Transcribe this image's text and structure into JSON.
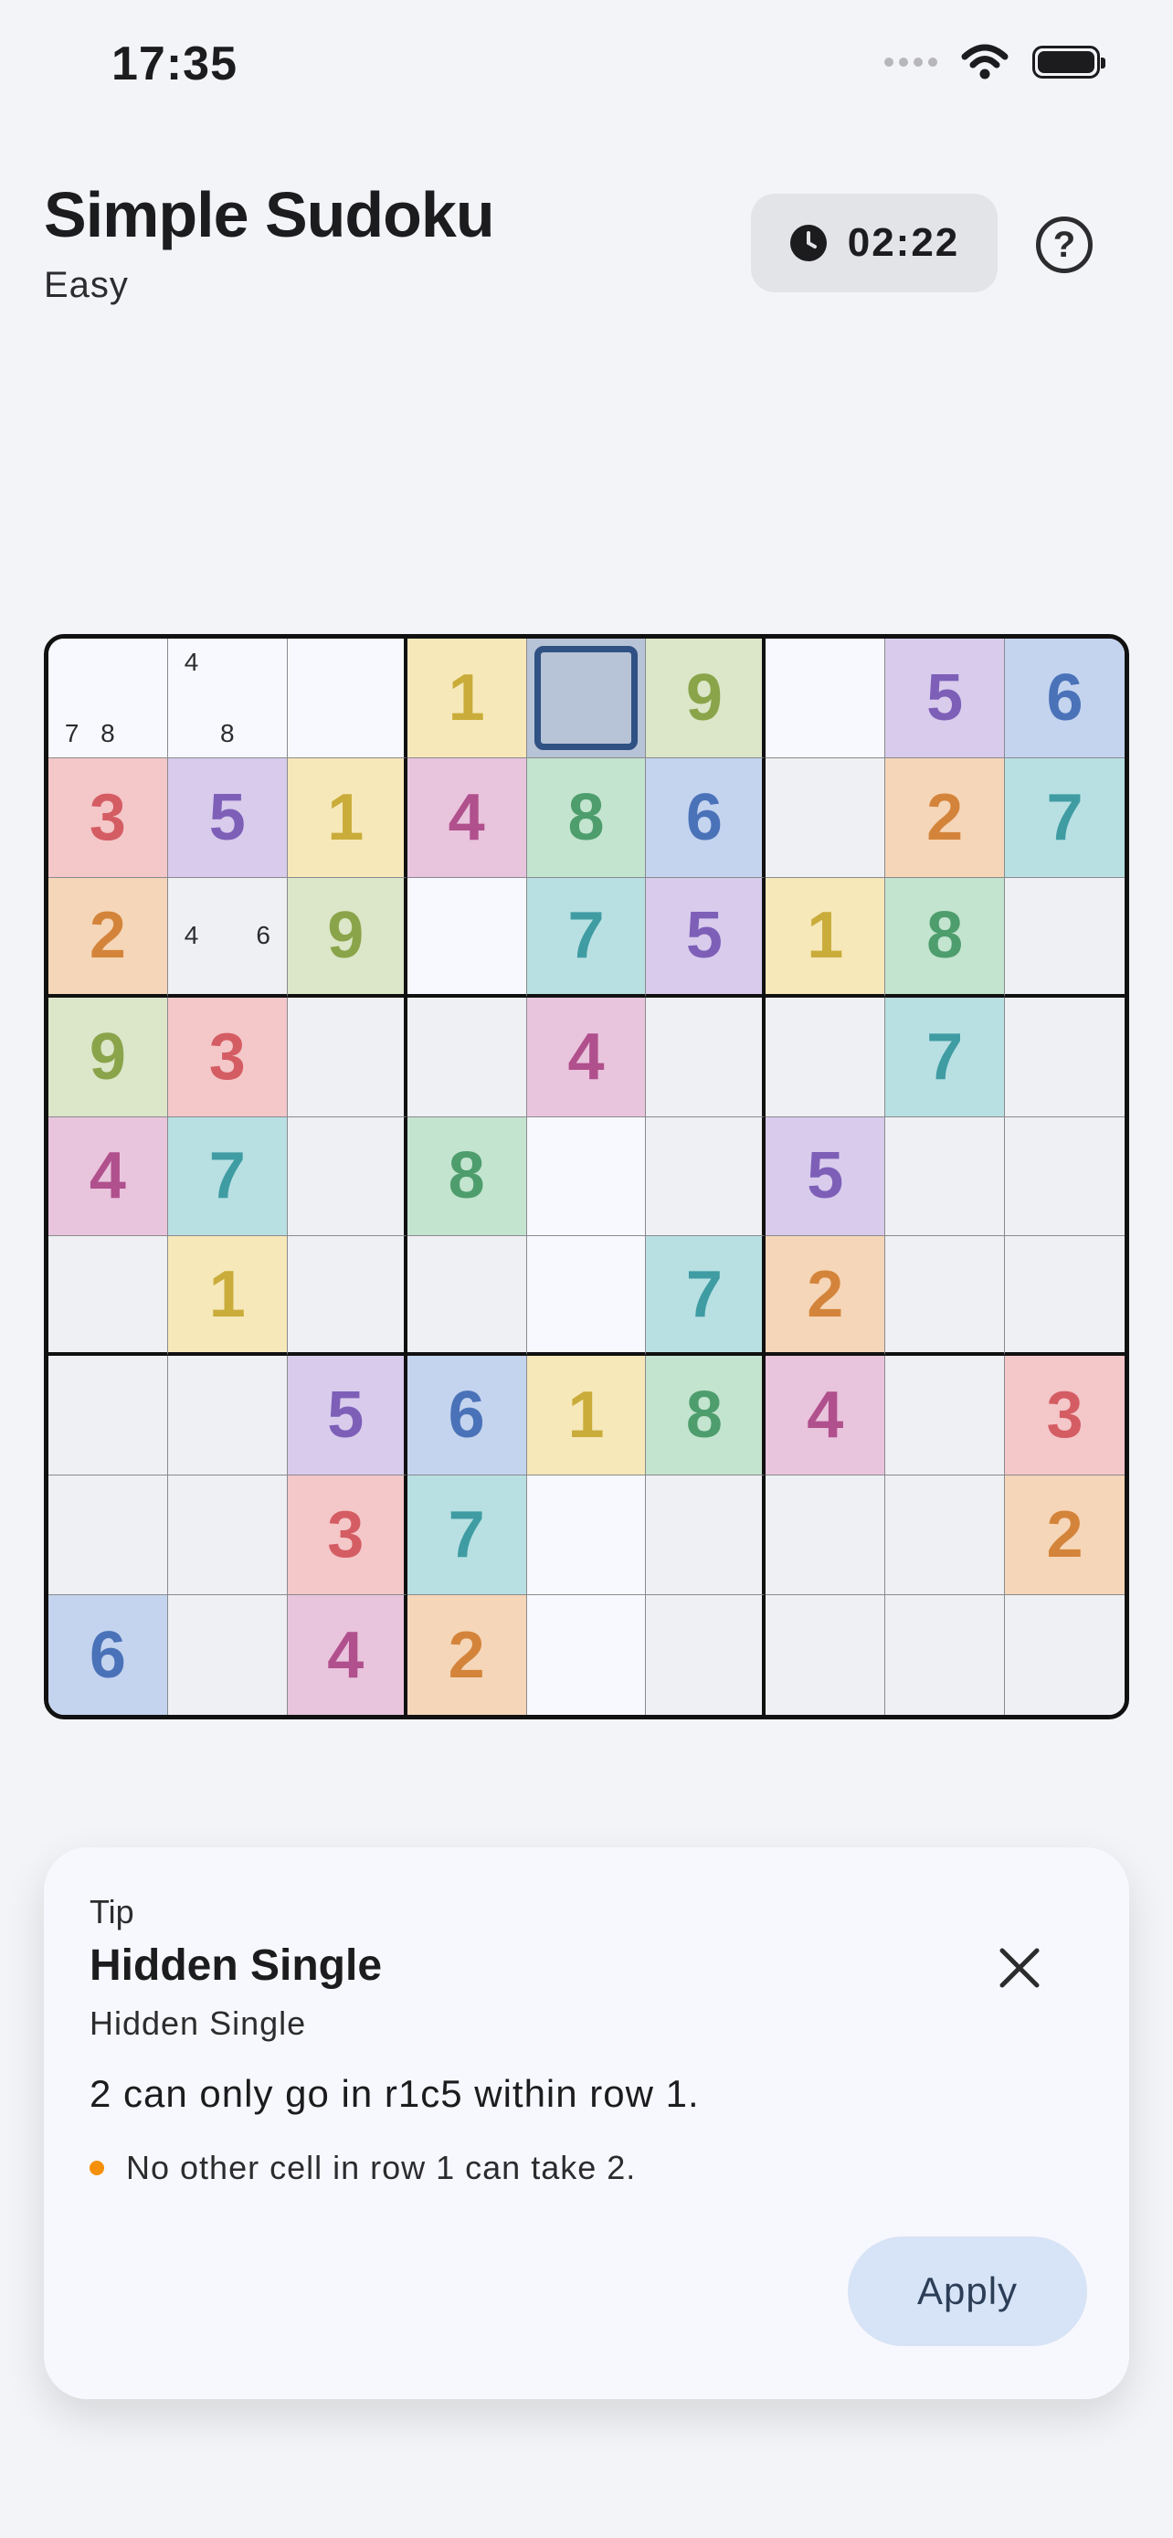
{
  "status_bar": {
    "time": "17:35"
  },
  "header": {
    "title": "Simple Sudoku",
    "difficulty": "Easy",
    "timer": "02:22"
  },
  "icons": {
    "help": "help-circle-icon",
    "timer": "clock-icon",
    "close": "close-icon",
    "wifi": "wifi-icon",
    "battery": "battery-icon"
  },
  "colors": {
    "selected_border": "#2f5183",
    "digits": {
      "1": {
        "bg": "#f6e8b8",
        "fg": "#c9ac3a"
      },
      "2": {
        "bg": "#f5d6b8",
        "fg": "#d4843a"
      },
      "3": {
        "bg": "#f4c7c9",
        "fg": "#d45d63"
      },
      "4": {
        "bg": "#e9c4dd",
        "fg": "#b0508d"
      },
      "5": {
        "bg": "#d8cbec",
        "fg": "#7d5fb8"
      },
      "6": {
        "bg": "#c4d4ef",
        "fg": "#4a72b8"
      },
      "7": {
        "bg": "#b8e0e3",
        "fg": "#3f9ca3"
      },
      "8": {
        "bg": "#c3e4cf",
        "fg": "#4e9d6d"
      },
      "9": {
        "bg": "#dce6c8",
        "fg": "#8aa44a"
      }
    },
    "empty_bg": "#eff0f3",
    "highlight_bg": "#f8f9fe",
    "selected_bg": "#b7c3d6"
  },
  "board": {
    "cells": [
      [
        {
          "v": "",
          "n": [
            "",
            "",
            "",
            "",
            "",
            "",
            "7",
            "8",
            ""
          ],
          "h": true
        },
        {
          "v": "",
          "n": [
            "4",
            "",
            "",
            "",
            "",
            "",
            "",
            "8",
            ""
          ],
          "h": true
        },
        {
          "v": "",
          "h": true
        },
        {
          "v": "1"
        },
        {
          "v": "",
          "sel": true
        },
        {
          "v": "9"
        },
        {
          "v": "",
          "h": true
        },
        {
          "v": "5"
        },
        {
          "v": "6"
        }
      ],
      [
        {
          "v": "3"
        },
        {
          "v": "5"
        },
        {
          "v": "1"
        },
        {
          "v": "4"
        },
        {
          "v": "8"
        },
        {
          "v": "6"
        },
        {
          "v": ""
        },
        {
          "v": "2"
        },
        {
          "v": "7"
        }
      ],
      [
        {
          "v": "2"
        },
        {
          "v": "",
          "n": [
            "",
            "",
            "",
            "4",
            "",
            "6",
            "",
            "",
            ""
          ]
        },
        {
          "v": "9"
        },
        {
          "v": "",
          "h": true
        },
        {
          "v": "7"
        },
        {
          "v": "5"
        },
        {
          "v": "1"
        },
        {
          "v": "8"
        },
        {
          "v": ""
        }
      ],
      [
        {
          "v": "9"
        },
        {
          "v": "3"
        },
        {
          "v": ""
        },
        {
          "v": ""
        },
        {
          "v": "4"
        },
        {
          "v": ""
        },
        {
          "v": ""
        },
        {
          "v": "7"
        },
        {
          "v": ""
        }
      ],
      [
        {
          "v": "4"
        },
        {
          "v": "7"
        },
        {
          "v": ""
        },
        {
          "v": "8"
        },
        {
          "v": "",
          "h": true
        },
        {
          "v": ""
        },
        {
          "v": "5"
        },
        {
          "v": ""
        },
        {
          "v": ""
        }
      ],
      [
        {
          "v": ""
        },
        {
          "v": "1"
        },
        {
          "v": ""
        },
        {
          "v": ""
        },
        {
          "v": "",
          "h": true
        },
        {
          "v": "7"
        },
        {
          "v": "2"
        },
        {
          "v": ""
        },
        {
          "v": ""
        }
      ],
      [
        {
          "v": ""
        },
        {
          "v": ""
        },
        {
          "v": "5"
        },
        {
          "v": "6"
        },
        {
          "v": "1"
        },
        {
          "v": "8"
        },
        {
          "v": "4"
        },
        {
          "v": ""
        },
        {
          "v": "3"
        }
      ],
      [
        {
          "v": ""
        },
        {
          "v": ""
        },
        {
          "v": "3"
        },
        {
          "v": "7"
        },
        {
          "v": "",
          "h": true
        },
        {
          "v": ""
        },
        {
          "v": ""
        },
        {
          "v": ""
        },
        {
          "v": "2"
        }
      ],
      [
        {
          "v": "6"
        },
        {
          "v": ""
        },
        {
          "v": "4"
        },
        {
          "v": "2"
        },
        {
          "v": "",
          "h": true
        },
        {
          "v": ""
        },
        {
          "v": ""
        },
        {
          "v": ""
        },
        {
          "v": ""
        }
      ]
    ]
  },
  "tip": {
    "label": "Tip",
    "title": "Hidden Single",
    "subtitle": "Hidden Single",
    "message": "2 can only go in r1c5 within row 1.",
    "reason": "No other cell in row 1 can take 2.",
    "apply_label": "Apply"
  }
}
